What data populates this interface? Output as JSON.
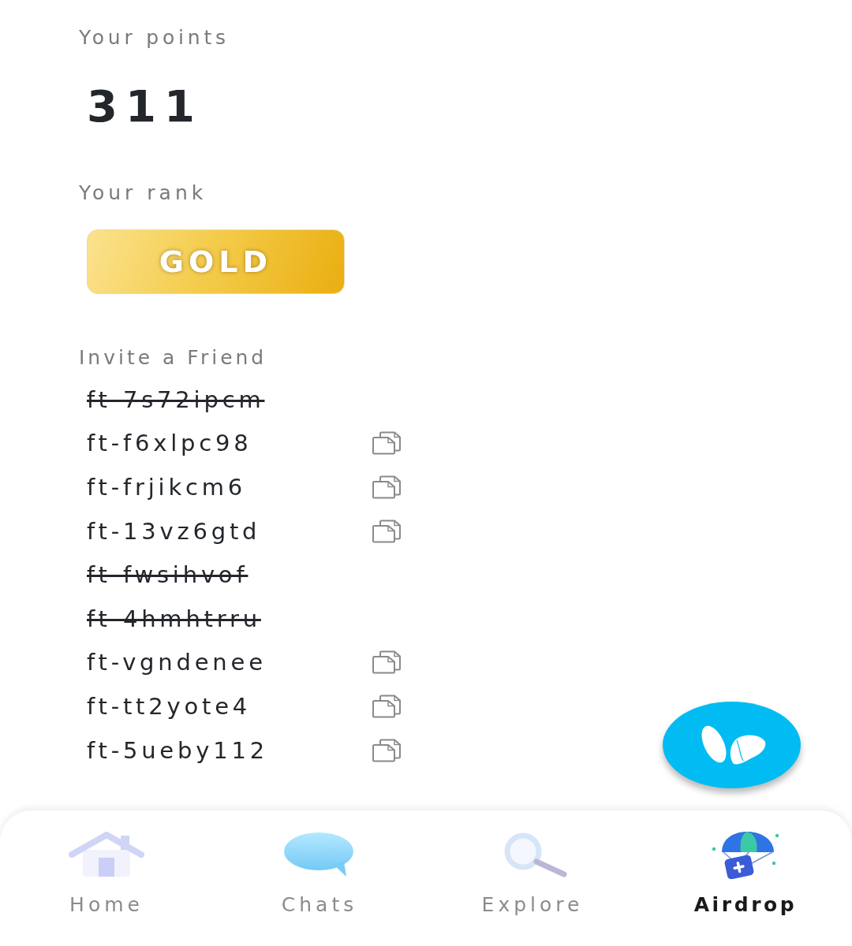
{
  "points": {
    "label": "Your points",
    "value": "311"
  },
  "rank": {
    "label": "Your rank",
    "badge": "GOLD"
  },
  "invite": {
    "label": "Invite a Friend",
    "codes": [
      {
        "code": "ft-7s72ipcm",
        "used": true
      },
      {
        "code": "ft-f6xlpc98",
        "used": false
      },
      {
        "code": "ft-frjikcm6",
        "used": false
      },
      {
        "code": "ft-13vz6gtd",
        "used": false
      },
      {
        "code": "ft-fwsihvof",
        "used": true
      },
      {
        "code": "ft-4hmhtrru",
        "used": true
      },
      {
        "code": "ft-vgndenee",
        "used": false
      },
      {
        "code": "ft-tt2yote4",
        "used": false
      },
      {
        "code": "ft-5ueby112",
        "used": false
      }
    ]
  },
  "nav": {
    "tabs": [
      {
        "label": "Home",
        "selected": false
      },
      {
        "label": "Chats",
        "selected": false
      },
      {
        "label": "Explore",
        "selected": false
      },
      {
        "label": "Airdrop",
        "selected": true
      }
    ]
  }
}
